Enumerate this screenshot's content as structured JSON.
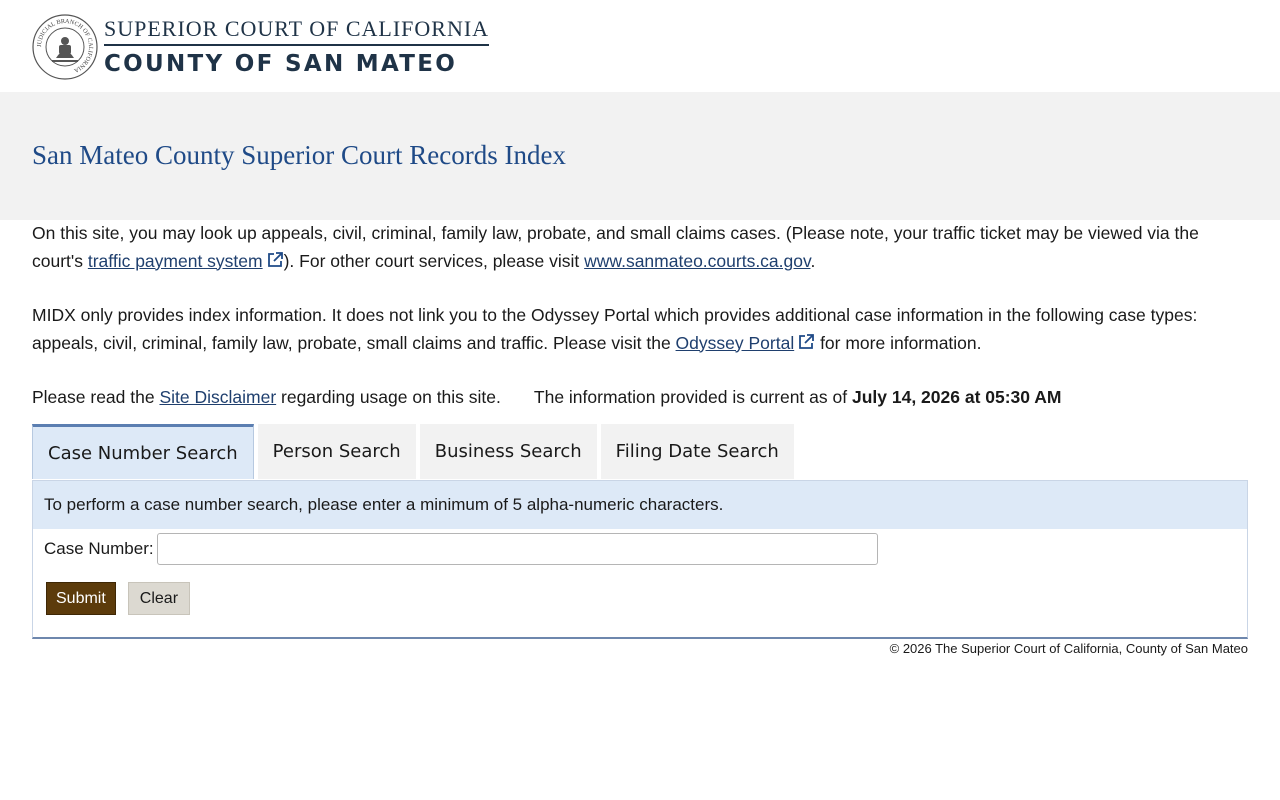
{
  "header": {
    "seal_text": "JUDICIAL BRANCH OF CALIFORNIA",
    "court_line": "SUPERIOR COURT OF CALIFORNIA",
    "county_line": "COUNTY OF SAN MATEO"
  },
  "page": {
    "title": "San Mateo County Superior Court Records Index"
  },
  "intro": {
    "p1_a": "On this site, you may look up appeals, civil, criminal, family law, probate, and small claims cases. (Please note, your traffic ticket may be viewed via the court's ",
    "p1_link": "traffic payment system",
    "p1_b": "). For other court services, please visit ",
    "p1_link2": "www.sanmateo.courts.ca.gov",
    "p1_c": ".",
    "p2_a": "MIDX only provides index information. It does not link you to the Odyssey Portal which provides additional case information in the following case types: appeals, civil, criminal, family law, probate, small claims and traffic. Please visit the ",
    "p2_link": "Odyssey Portal",
    "p2_b": " for more information.",
    "p3_a": "Please read the ",
    "p3_link": "Site Disclaimer",
    "p3_b": " regarding usage on this site.",
    "current_prefix": "The information provided is current as of ",
    "current_date": "July 14, 2026 at 05:30 AM"
  },
  "tabs": [
    {
      "label": "Case Number Search",
      "active": true
    },
    {
      "label": "Person Search",
      "active": false
    },
    {
      "label": "Business Search",
      "active": false
    },
    {
      "label": "Filing Date Search",
      "active": false
    }
  ],
  "panel": {
    "notice": "To perform a case number search, please enter a minimum of 5 alpha-numeric characters.",
    "field_label": "Case Number:",
    "field_value": "",
    "submit_label": "Submit",
    "clear_label": "Clear"
  },
  "footer": {
    "text": "© 2026 The Superior Court of California, County of San Mateo"
  },
  "colors": {
    "title": "#1f4a87",
    "link": "#1f3f6e",
    "submit": "#5c3b0b",
    "tab_active": "#dde9f7"
  },
  "icons": {
    "external_link": "external-link-icon",
    "seal": "court-seal-icon"
  }
}
